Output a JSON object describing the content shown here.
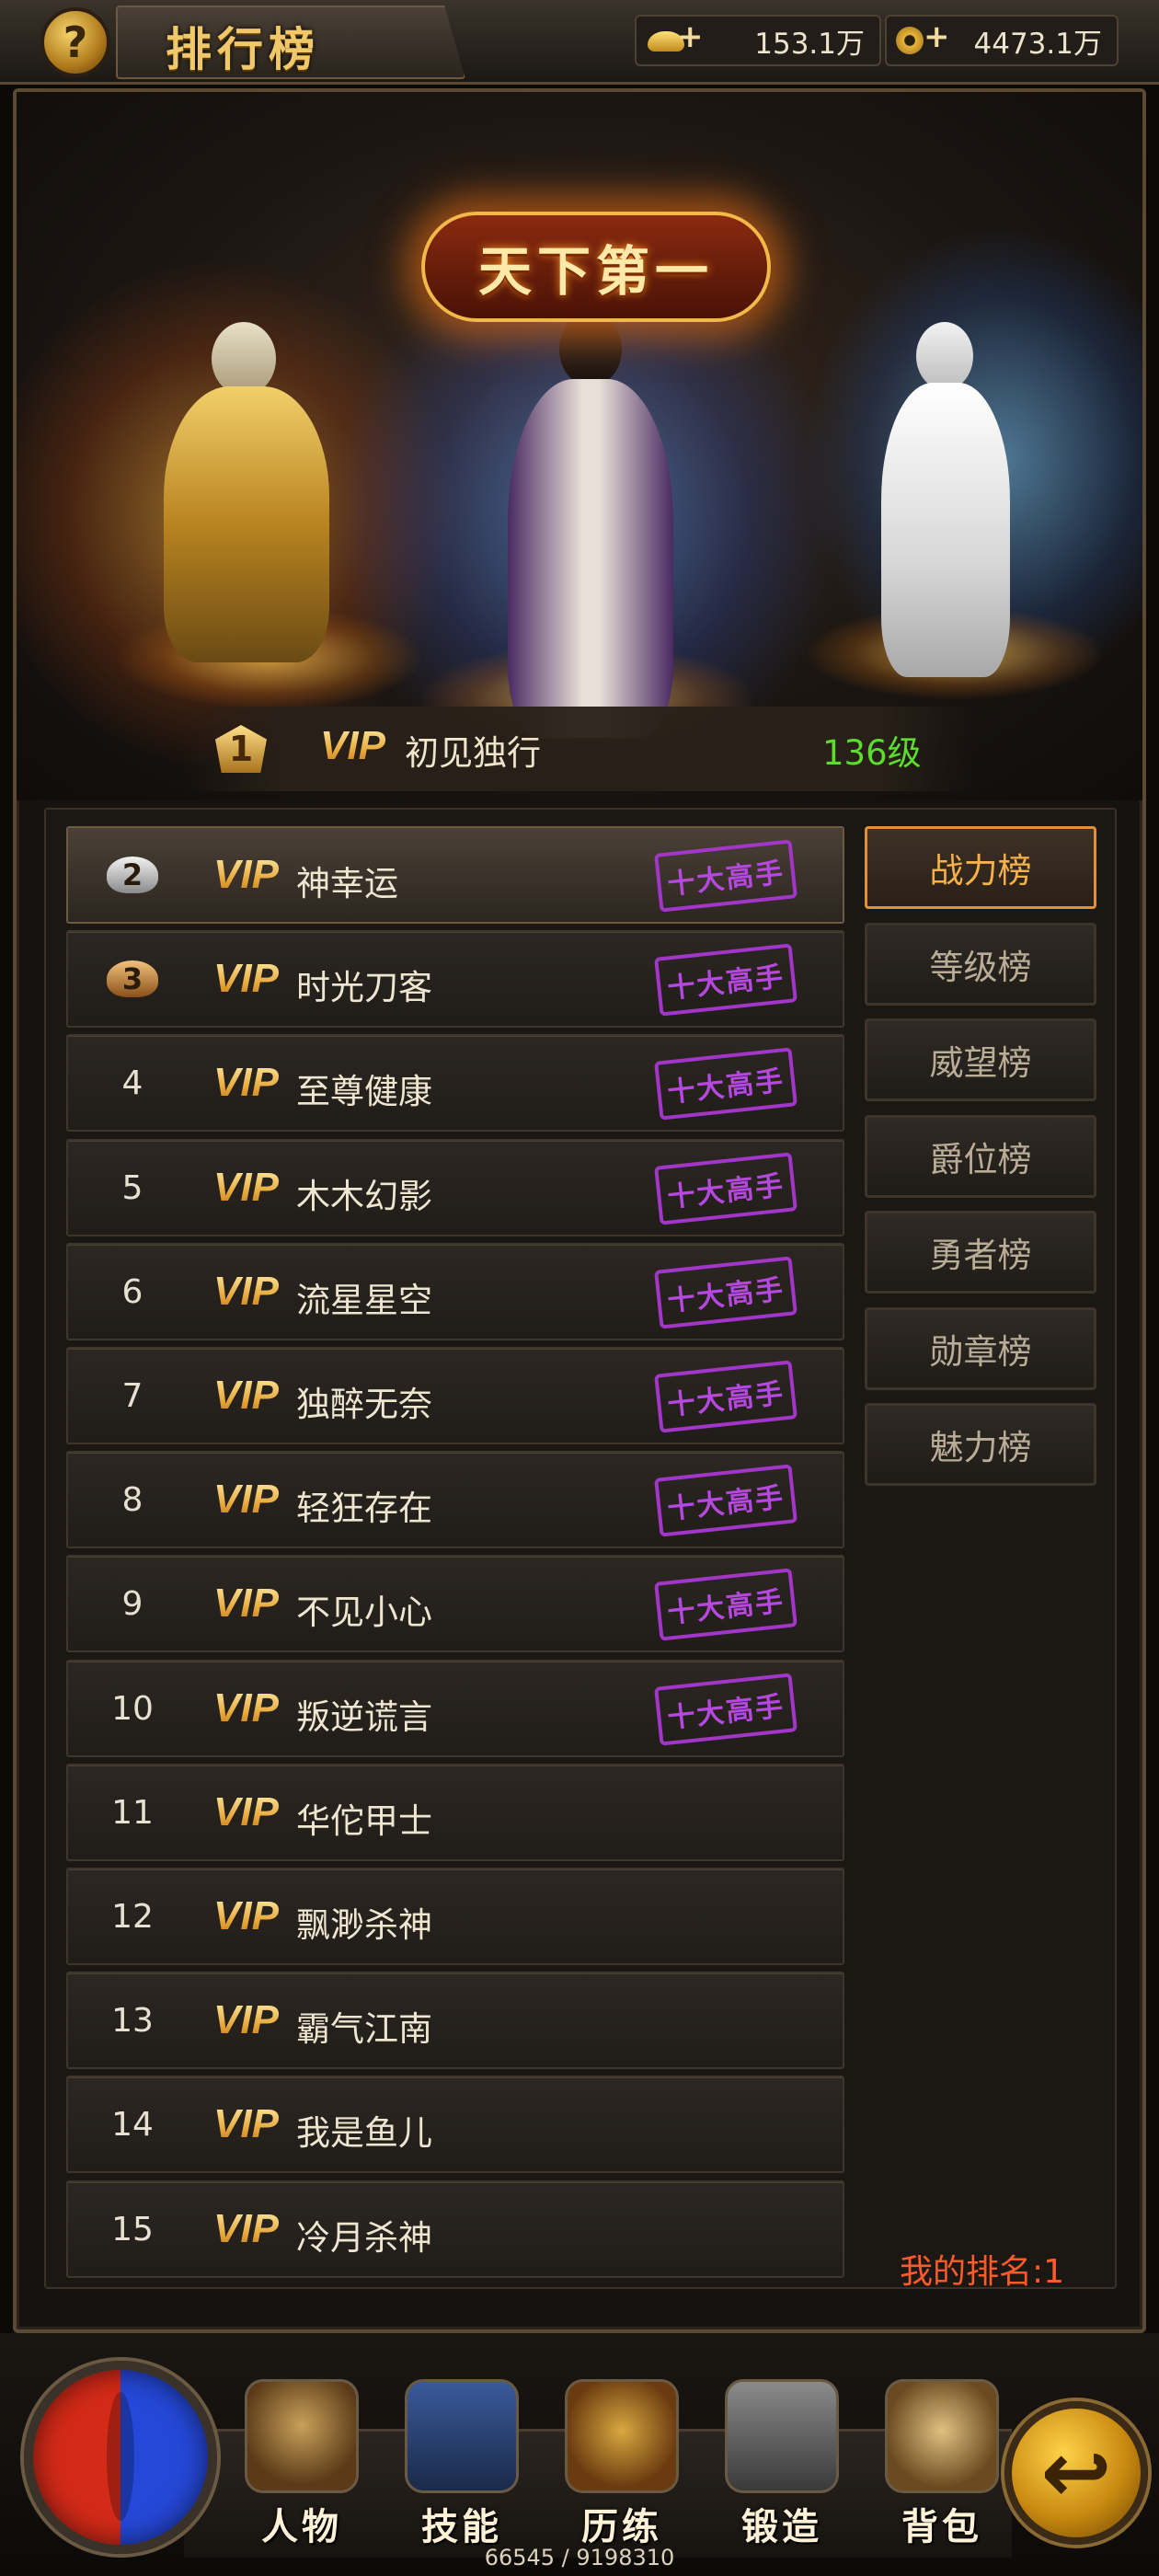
{
  "header": {
    "title": "排行榜",
    "help_label": "?",
    "gold": "153.1万",
    "coins": "4473.1万",
    "close_label": "✕"
  },
  "hero": {
    "banner": "天下第一",
    "top_rank": "1",
    "top_vip": "VIP",
    "top_name": "初见独行",
    "top_level": "136级"
  },
  "ranking": {
    "badge": "十大高手",
    "rows": [
      {
        "rank": "2",
        "vip": "VIP",
        "name": "神幸运"
      },
      {
        "rank": "3",
        "vip": "VIP",
        "name": "时光刀客"
      },
      {
        "rank": "4",
        "vip": "VIP",
        "name": "至尊健康"
      },
      {
        "rank": "5",
        "vip": "VIP",
        "name": "木木幻影"
      },
      {
        "rank": "6",
        "vip": "VIP",
        "name": "流星星空"
      },
      {
        "rank": "7",
        "vip": "VIP",
        "name": "独醉无奈"
      },
      {
        "rank": "8",
        "vip": "VIP",
        "name": "轻狂存在"
      },
      {
        "rank": "9",
        "vip": "VIP",
        "name": "不见小心"
      },
      {
        "rank": "10",
        "vip": "VIP",
        "name": "叛逆谎言"
      },
      {
        "rank": "11",
        "vip": "VIP",
        "name": "华佗甲士"
      },
      {
        "rank": "12",
        "vip": "VIP",
        "name": "飘渺杀神"
      },
      {
        "rank": "13",
        "vip": "VIP",
        "name": "霸气江南"
      },
      {
        "rank": "14",
        "vip": "VIP",
        "name": "我是鱼儿"
      },
      {
        "rank": "15",
        "vip": "VIP",
        "name": "冷月杀神"
      }
    ]
  },
  "tabs": [
    "战力榜",
    "等级榜",
    "威望榜",
    "爵位榜",
    "勇者榜",
    "勋章榜",
    "魅力榜"
  ],
  "active_tab": "战力榜",
  "my_rank": "我的排名:1",
  "nav": {
    "items": [
      "人物",
      "技能",
      "历练",
      "锻造",
      "背包"
    ],
    "back_label": "↩",
    "exp": "66545 / 9198310"
  },
  "colors": {
    "accent": "#f5b14a",
    "level_green": "#5cdc2c",
    "stamp_purple": "#a236c8",
    "my_rank_red": "#ff5a2a"
  }
}
